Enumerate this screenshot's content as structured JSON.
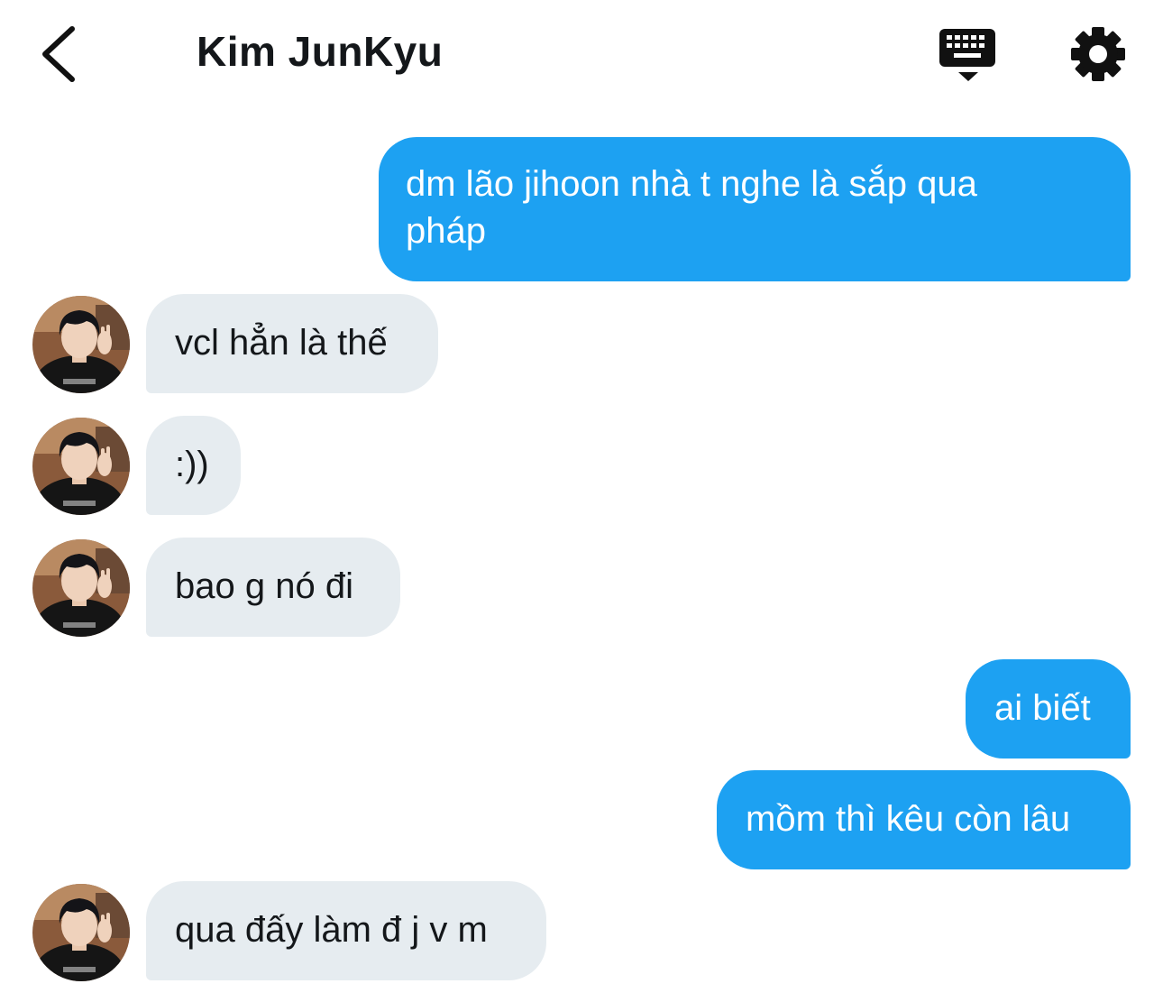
{
  "header": {
    "title": "Kim JunKyu",
    "back_icon": "chevron-left-icon",
    "keyboard_icon": "keyboard-icon",
    "settings_icon": "gear-icon"
  },
  "colors": {
    "sent_bubble": "#1da1f2",
    "received_bubble": "#e6ecf0"
  },
  "messages": [
    {
      "direction": "sent",
      "line1": "dm lão jihoon nhà t nghe là sắp qua",
      "line2": "pháp"
    },
    {
      "direction": "received",
      "text": "vcl hẳn là thế"
    },
    {
      "direction": "received",
      "text": ":))"
    },
    {
      "direction": "received",
      "text": "bao g nó đi"
    },
    {
      "direction": "sent",
      "text": "ai biết"
    },
    {
      "direction": "sent",
      "text": "mồm thì kêu còn lâu"
    },
    {
      "direction": "received",
      "text": "qua đấy làm đ j v m"
    }
  ]
}
